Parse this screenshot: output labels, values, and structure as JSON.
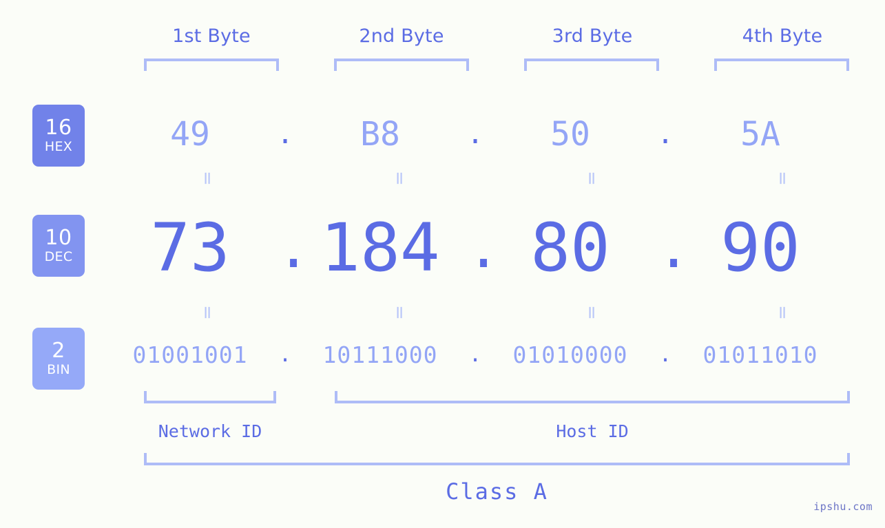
{
  "page": {
    "background_color": "#fbfdf8",
    "accent_dark": "#5b6ce4",
    "accent_mid": "#8294f0",
    "accent_light": "#93a5f6",
    "bracket_color": "#aebcf7",
    "watermark": "ipshu.com"
  },
  "headers": [
    {
      "label": "1st Byte"
    },
    {
      "label": "2nd Byte"
    },
    {
      "label": "3rd Byte"
    },
    {
      "label": "4th Byte"
    }
  ],
  "bases": [
    {
      "id": "hex",
      "number": "16",
      "name": "HEX",
      "color": "#7182e9"
    },
    {
      "id": "dec",
      "number": "10",
      "name": "DEC",
      "color": "#8294f0"
    },
    {
      "id": "bin",
      "number": "2",
      "name": "BIN",
      "color": "#95a9f8"
    }
  ],
  "separator": ".",
  "equals": "=",
  "rows": {
    "hex": {
      "base": 16,
      "values": [
        "49",
        "B8",
        "50",
        "5A"
      ]
    },
    "dec": {
      "base": 10,
      "values": [
        "73",
        "184",
        "80",
        "90"
      ]
    },
    "bin": {
      "base": 2,
      "values": [
        "01001001",
        "10111000",
        "01010000",
        "01011010"
      ]
    }
  },
  "ip_address": {
    "dotted_decimal": "73.184.80.90",
    "hexadecimal": "49.B8.50.5A",
    "binary": "01001001.10111000.01010000.01011010"
  },
  "segments": {
    "network_id": "Network ID",
    "host_id": "Host ID",
    "class": "Class A"
  }
}
